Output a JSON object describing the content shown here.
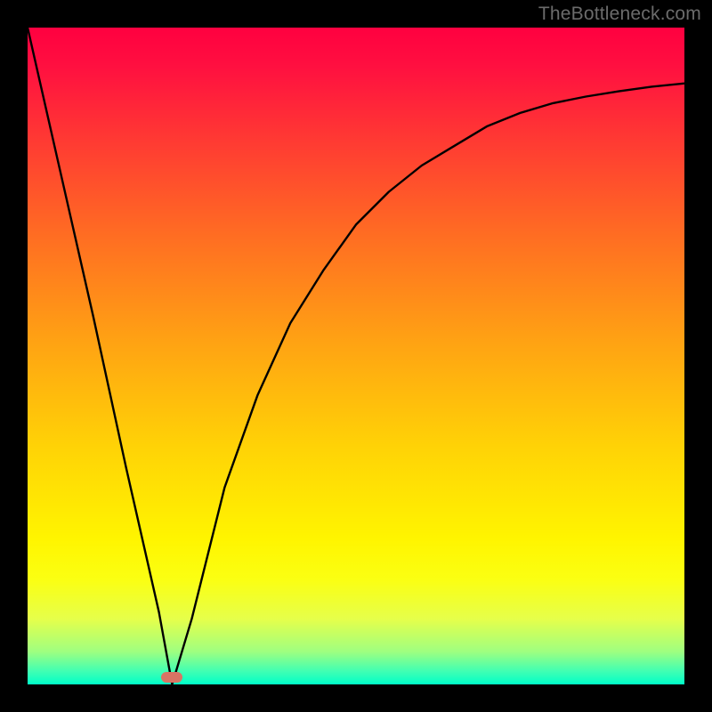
{
  "watermark": "TheBottleneck.com",
  "colors": {
    "frame": "#000000",
    "curve": "#000000",
    "marker": "#d97464",
    "gradient_top": "#ff0040",
    "gradient_bottom": "#00ffc8"
  },
  "chart_data": {
    "type": "line",
    "title": "",
    "xlabel": "",
    "ylabel": "",
    "xlim": [
      0,
      100
    ],
    "ylim": [
      0,
      100
    ],
    "series": [
      {
        "name": "bottleneck-curve",
        "x": [
          0,
          5,
          10,
          15,
          20,
          22,
          25,
          30,
          35,
          40,
          45,
          50,
          55,
          60,
          65,
          70,
          75,
          80,
          85,
          90,
          95,
          100
        ],
        "values": [
          100,
          78,
          56,
          33,
          11,
          0,
          10,
          30,
          44,
          55,
          63,
          70,
          75,
          79,
          82,
          85,
          87,
          88.5,
          89.5,
          90.3,
          91,
          91.5
        ]
      }
    ],
    "annotations": [
      {
        "name": "current-point",
        "x": 22,
        "y": 0
      }
    ],
    "grid": false,
    "legend": false
  }
}
